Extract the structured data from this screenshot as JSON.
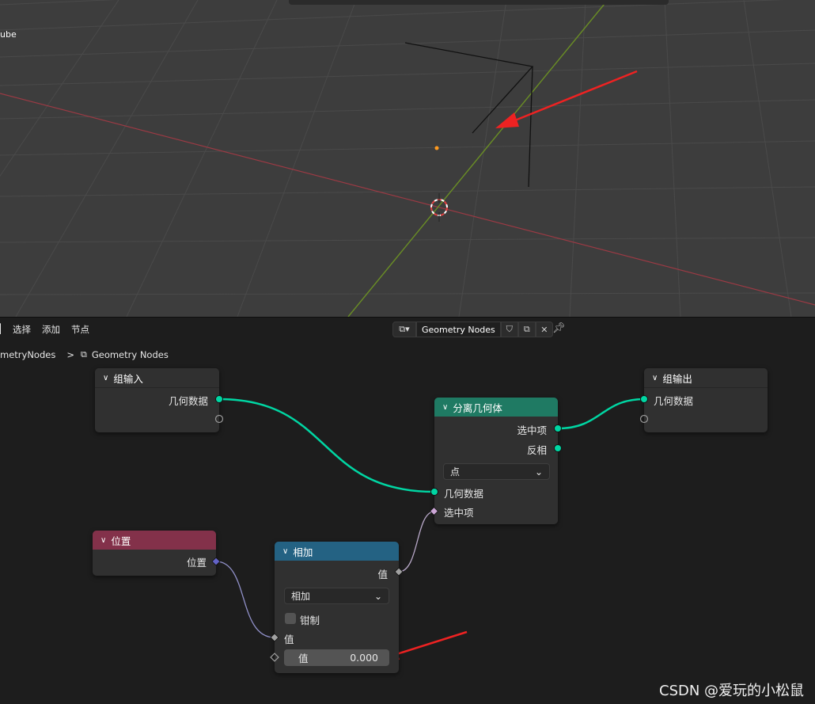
{
  "viewport": {
    "object_label": "ube"
  },
  "node_editor": {
    "menu": [
      "选择",
      "添加",
      "节点"
    ],
    "tree_name": "Geometry Nodes",
    "breadcrumb": {
      "parent": "metryNodes",
      "separator": ">",
      "current": "Geometry Nodes"
    }
  },
  "nodes": {
    "group_input": {
      "title": "组输入",
      "outputs": [
        "几何数据"
      ]
    },
    "group_output": {
      "title": "组输出",
      "inputs": [
        "几何数据"
      ]
    },
    "separate_geometry": {
      "title": "分离几何体",
      "outputs": [
        "选中项",
        "反相"
      ],
      "domain": "点",
      "inputs": [
        "几何数据",
        "选中项"
      ]
    },
    "position": {
      "title": "位置",
      "outputs": [
        "位置"
      ]
    },
    "math_add": {
      "title": "相加",
      "output": "值",
      "operation": "相加",
      "clamp_label": "钳制",
      "input1": "值",
      "input2_label": "值",
      "input2_value": "0.000"
    }
  },
  "colors": {
    "geometry_socket": "#00d6a3",
    "group_header": "#303030",
    "separate_header": "#1f7a63",
    "input_header": "#83314a",
    "math_header": "#246283",
    "float_socket": "#a1a1a1",
    "vector_socket": "#6363c7",
    "bool_socket": "#cca6d6",
    "annotation_arrow": "#ee2222"
  },
  "watermark": "CSDN @爱玩的小松鼠"
}
